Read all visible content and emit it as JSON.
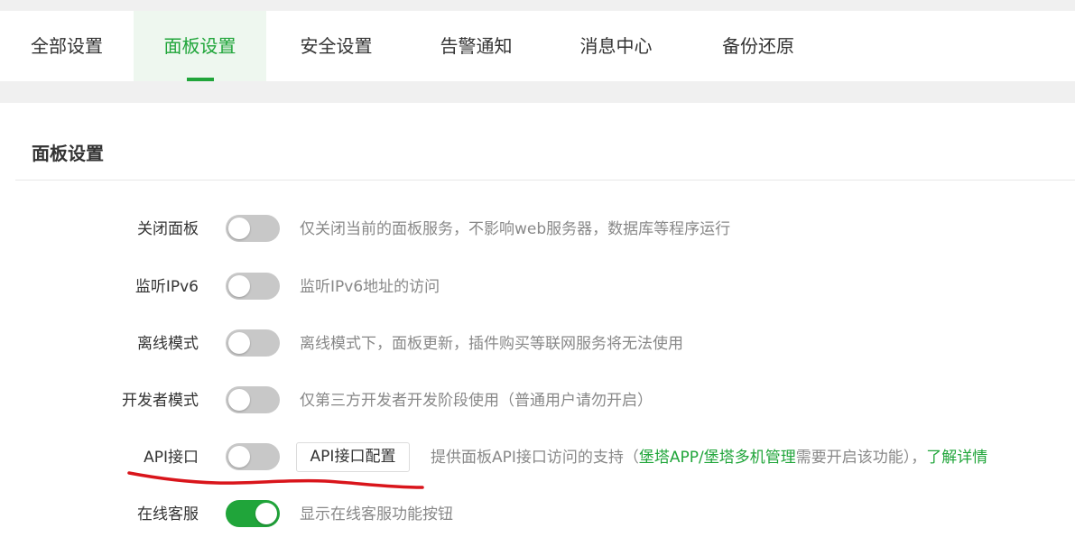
{
  "tabs": [
    {
      "label": "全部设置",
      "active": false
    },
    {
      "label": "面板设置",
      "active": true
    },
    {
      "label": "安全设置",
      "active": false
    },
    {
      "label": "告警通知",
      "active": false
    },
    {
      "label": "消息中心",
      "active": false
    },
    {
      "label": "备份还原",
      "active": false
    }
  ],
  "panel": {
    "title": "面板设置"
  },
  "settings": {
    "close_panel": {
      "label": "关闭面板",
      "enabled": false,
      "description": "仅关闭当前的面板服务，不影响web服务器，数据库等程序运行"
    },
    "listen_ipv6": {
      "label": "监听IPv6",
      "enabled": false,
      "description": "监听IPv6地址的访问"
    },
    "offline_mode": {
      "label": "离线模式",
      "enabled": false,
      "description": "离线模式下，面板更新，插件购买等联网服务将无法使用"
    },
    "developer_mode": {
      "label": "开发者模式",
      "enabled": false,
      "description": "仅第三方开发者开发阶段使用（普通用户请勿开启）"
    },
    "api": {
      "label": "API接口",
      "enabled": false,
      "config_button": "API接口配置",
      "description_prefix": "提供面板API接口访问的支持（",
      "description_highlight": "堡塔APP/堡塔多机管理",
      "description_suffix": "需要开启该功能），",
      "learn_more": "了解详情"
    },
    "online_service": {
      "label": "在线客服",
      "enabled": true,
      "description": "显示在线客服功能按钮"
    }
  },
  "colors": {
    "accent": "#20a53a",
    "annotation": "#d9151b"
  }
}
